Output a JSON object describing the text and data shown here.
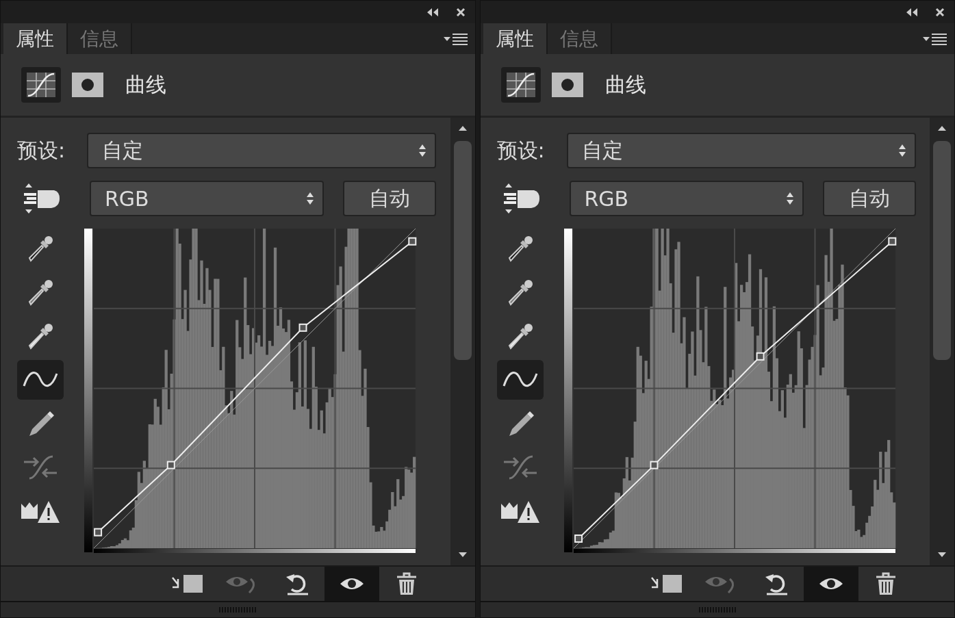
{
  "panels": [
    {
      "tabs": [
        {
          "label": "属性",
          "selected": true
        },
        {
          "label": "信息",
          "selected": false
        }
      ],
      "header_icons": [
        {
          "kind": "adjustment",
          "selected": true
        },
        {
          "kind": "mask",
          "selected": false
        }
      ],
      "title": "曲线",
      "preset": {
        "label": "预设:",
        "value": "自定"
      },
      "channel": {
        "value": "RGB"
      },
      "auto_button": "自动",
      "tools": [
        {
          "kind": "black-eyedropper",
          "selected": false
        },
        {
          "kind": "gray-eyedropper",
          "selected": false
        },
        {
          "kind": "white-eyedropper",
          "selected": false
        },
        {
          "kind": "curve",
          "selected": true
        },
        {
          "kind": "pencil",
          "selected": false
        },
        {
          "kind": "smooth",
          "selected": false
        },
        {
          "kind": "clipping",
          "selected": false
        }
      ],
      "footer_buttons": [
        {
          "kind": "clip",
          "on": false
        },
        {
          "kind": "view-previous",
          "on": false
        },
        {
          "kind": "reset",
          "on": false
        },
        {
          "kind": "visibility",
          "on": true
        },
        {
          "kind": "delete",
          "on": false
        }
      ]
    },
    {
      "tabs": [
        {
          "label": "属性",
          "selected": true
        },
        {
          "label": "信息",
          "selected": false
        }
      ],
      "header_icons": [
        {
          "kind": "adjustment",
          "selected": true
        },
        {
          "kind": "mask",
          "selected": false
        }
      ],
      "title": "曲线",
      "preset": {
        "label": "预设:",
        "value": "自定"
      },
      "channel": {
        "value": "RGB"
      },
      "auto_button": "自动",
      "tools": [
        {
          "kind": "black-eyedropper",
          "selected": false
        },
        {
          "kind": "gray-eyedropper",
          "selected": false
        },
        {
          "kind": "white-eyedropper",
          "selected": false
        },
        {
          "kind": "curve",
          "selected": true
        },
        {
          "kind": "pencil",
          "selected": false
        },
        {
          "kind": "smooth",
          "selected": false
        },
        {
          "kind": "clipping",
          "selected": false
        }
      ],
      "footer_buttons": [
        {
          "kind": "clip",
          "on": false
        },
        {
          "kind": "view-previous",
          "on": false
        },
        {
          "kind": "reset",
          "on": false
        },
        {
          "kind": "visibility",
          "on": true
        },
        {
          "kind": "delete",
          "on": false
        }
      ]
    }
  ]
}
